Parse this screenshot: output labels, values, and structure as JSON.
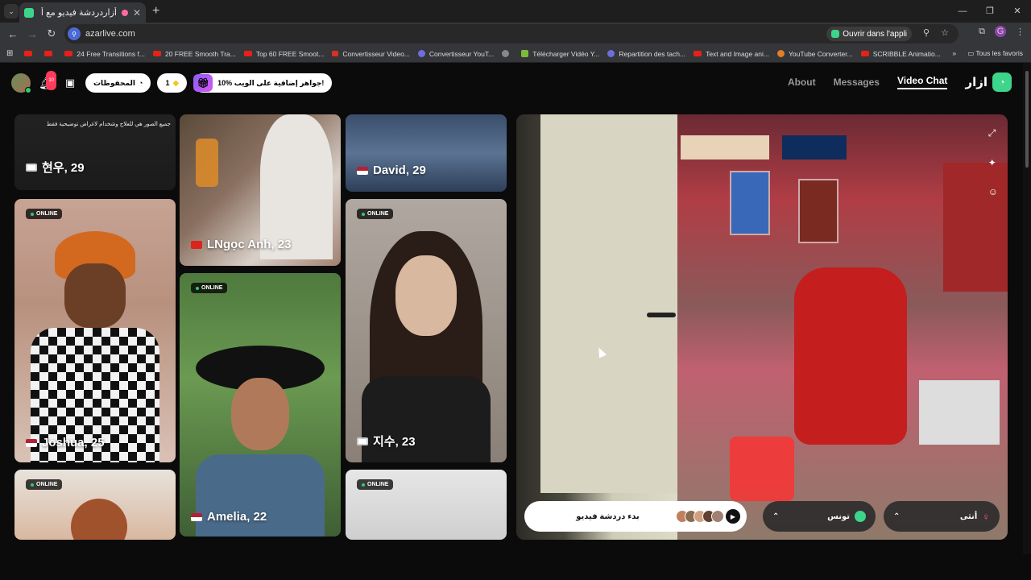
{
  "browser": {
    "tab": {
      "title": "أزاردردشة فيديو مع أشخاص"
    },
    "url": "azarlive.com",
    "open_app_label": "Ouvrir dans l'appli",
    "bookmarks": [
      {
        "label": "",
        "icon": "youtube-icon"
      },
      {
        "label": "",
        "icon": "youtube-icon"
      },
      {
        "label": "24 Free Transitions f...",
        "icon": "youtube-icon"
      },
      {
        "label": "20 FREE Smooth Tra...",
        "icon": "youtube-icon"
      },
      {
        "label": "Top 60 FREE Smoot...",
        "icon": "youtube-icon"
      },
      {
        "label": "Convertisseur Video...",
        "icon": "z-icon"
      },
      {
        "label": "Convertisseur YouT...",
        "icon": "cloud-icon"
      },
      {
        "label": "",
        "icon": "globe-icon"
      },
      {
        "label": "Télécharger Vidéo Y...",
        "icon": "download-icon"
      },
      {
        "label": "Repartition des tach...",
        "icon": "doc-icon"
      },
      {
        "label": "Text and Image ani...",
        "icon": "youtube-icon"
      },
      {
        "label": "YouTube Converter...",
        "icon": "star-icon"
      },
      {
        "label": "SCRIBBLE Animatio...",
        "icon": "youtube-icon"
      }
    ],
    "all_bookmarks_label": "Tous les favoris",
    "profile_letter": "G"
  },
  "header": {
    "notification_count": "10",
    "saved_label": "المحفوظات",
    "gems_count": "1",
    "promo_label": "10% جواهر إضافية على الويب!",
    "nav": [
      {
        "label": "About"
      },
      {
        "label": "Messages"
      },
      {
        "label": "Video Chat"
      }
    ],
    "logo_text": "ازار"
  },
  "cards": [
    {
      "name": "현우, 29",
      "online": false,
      "caption": "جميع الصور هي للعلاج وشخدام لاغراض توضيحية فقط"
    },
    {
      "name": "LNgọc Anh, 23",
      "online": false,
      "caption": ""
    },
    {
      "name": "David, 29",
      "online": false,
      "caption": ""
    },
    {
      "name": "Joshua, 25",
      "online": true,
      "caption": ""
    },
    {
      "name": "Amelia, 22",
      "online": true,
      "caption": ""
    },
    {
      "name": "지수, 23",
      "online": true,
      "caption": ""
    },
    {
      "name": "",
      "online": true,
      "caption": ""
    },
    {
      "name": "",
      "online": true,
      "caption": ""
    }
  ],
  "online_label": "ONLINE",
  "video": {
    "start_label": "بدء دردشة فيديو",
    "country_label": "تونس",
    "gender_label": "أنثى"
  }
}
